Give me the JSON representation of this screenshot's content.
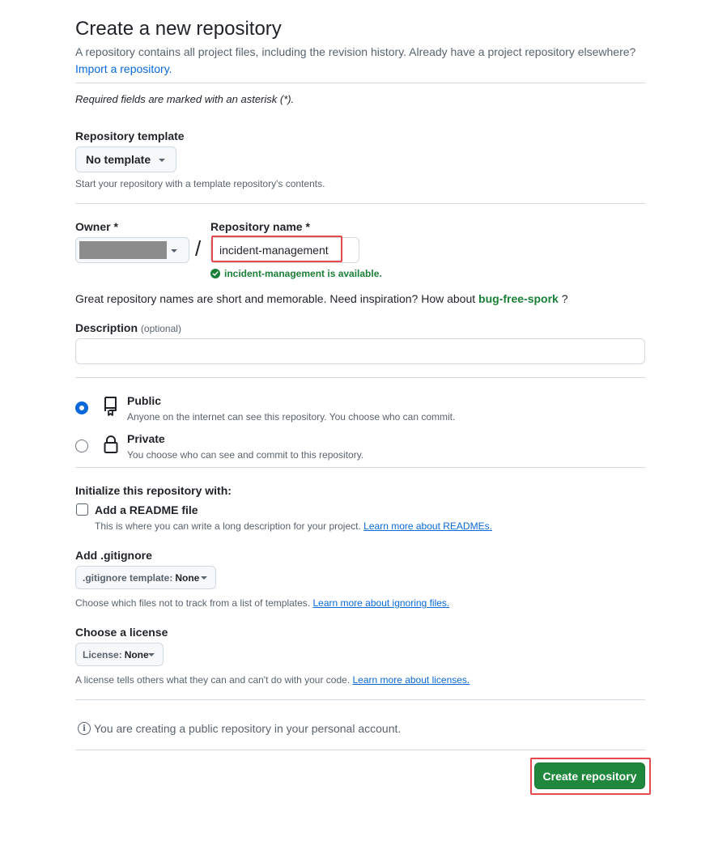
{
  "header": {
    "title": "Create a new repository",
    "subtitle": "A repository contains all project files, including the revision history. Already have a project repository elsewhere?",
    "import_link": "Import a repository."
  },
  "required_note": "Required fields are marked with an asterisk (*).",
  "template": {
    "label": "Repository template",
    "selected": "No template",
    "help": "Start your repository with a template repository's contents."
  },
  "owner": {
    "label": "Owner *"
  },
  "separator": "/",
  "repo_name": {
    "label": "Repository name *",
    "value": "incident-management",
    "availability": "incident-management is available."
  },
  "inspiration": {
    "prefix": "Great repository names are short and memorable. Need inspiration? How about",
    "suggestion": "bug-free-spork",
    "suffix": "?"
  },
  "description": {
    "label": "Description",
    "optional": "(optional)",
    "value": ""
  },
  "visibility": {
    "public": {
      "title": "Public",
      "desc": "Anyone on the internet can see this repository. You choose who can commit.",
      "selected": true
    },
    "private": {
      "title": "Private",
      "desc": "You choose who can see and commit to this repository.",
      "selected": false
    }
  },
  "initialize": {
    "label": "Initialize this repository with:",
    "readme_label": "Add a README file",
    "readme_help": "This is where you can write a long description for your project.",
    "readme_link": "Learn more about READMEs.",
    "readme_checked": false
  },
  "gitignore": {
    "label": "Add .gitignore",
    "select_prefix": ".gitignore template:",
    "select_value": "None",
    "help": "Choose which files not to track from a list of templates.",
    "link": "Learn more about ignoring files."
  },
  "license": {
    "label": "Choose a license",
    "select_prefix": "License:",
    "select_value": "None",
    "help": "A license tells others what they can and can't do with your code.",
    "link": "Learn more about licenses."
  },
  "info": {
    "icon_glyph": "i",
    "text": "You are creating a public repository in your personal account."
  },
  "submit": {
    "label": "Create repository"
  },
  "colors": {
    "primary_button": "#1f883d",
    "link": "#0969da",
    "success": "#1a7f37",
    "highlight": "#e5484d"
  }
}
